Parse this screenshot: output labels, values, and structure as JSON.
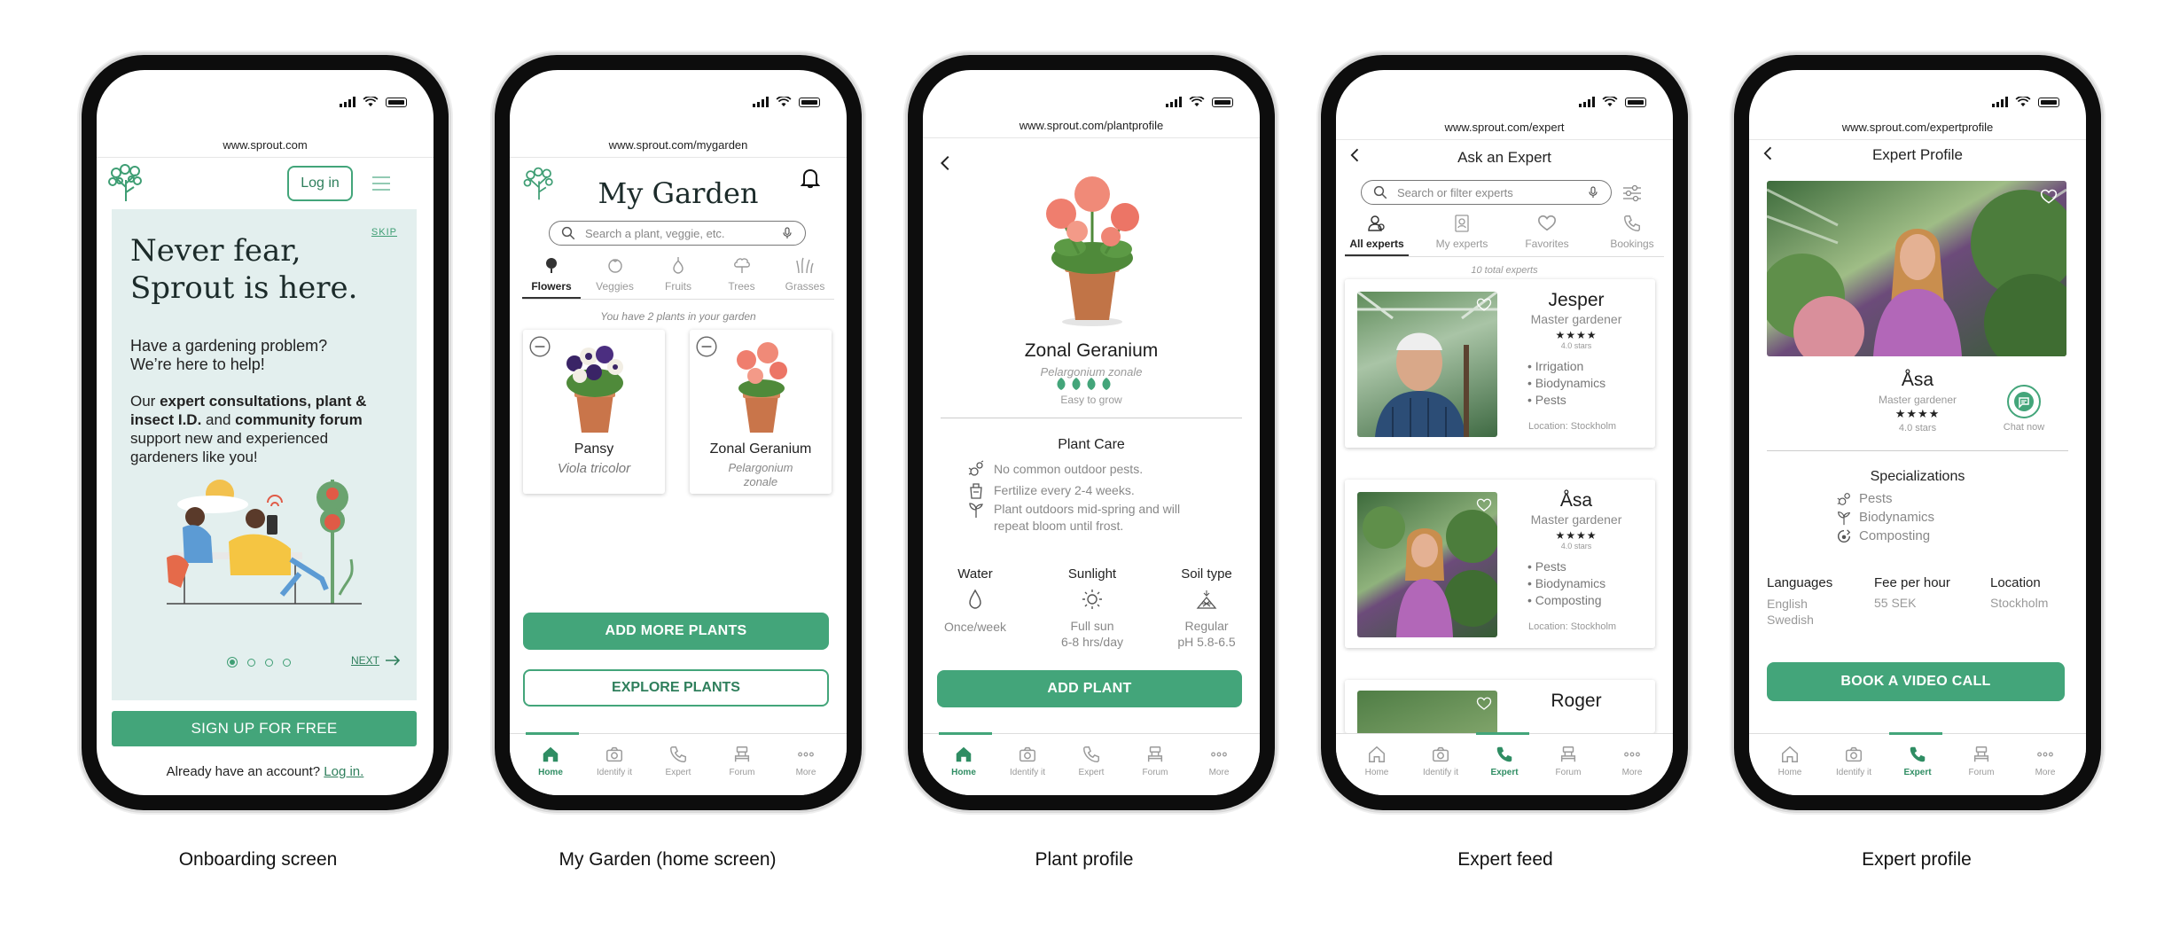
{
  "colors": {
    "accent": "#43a57a",
    "onboarding_bg": "#e3efee"
  },
  "captions": [
    "Onboarding screen",
    "My Garden (home screen)",
    "Plant profile",
    "Expert feed",
    "Expert profile"
  ],
  "nav": {
    "home": "Home",
    "identify": "Identify it",
    "expert": "Expert",
    "forum": "Forum",
    "more": "More"
  },
  "onboarding": {
    "url": "www.sprout.com",
    "login_button": "Log in",
    "skip": "SKIP",
    "headline_1": "Never fear,",
    "headline_2": "Sprout is here.",
    "problem_1": "Have a gardening problem?",
    "problem_2": "We’re here to help!",
    "body_1": "Our ",
    "body_bold_1": "expert consultations, plant &",
    "body_bold_2": "insect I.D.",
    "body_2": " and ",
    "body_bold_3": "community forum",
    "body_3": "support new and experienced",
    "body_4": "gardeners like you!",
    "next": "NEXT",
    "signup": "SIGN UP FOR FREE",
    "have_account": "Already have an account? ",
    "login_link": "Log in."
  },
  "garden": {
    "url": "www.sprout.com/mygarden",
    "title": "My Garden",
    "search_placeholder": "Search a plant, veggie, etc.",
    "categories": [
      "Flowers",
      "Veggies",
      "Fruits",
      "Trees",
      "Grasses"
    ],
    "count_note": "You have 2 plants in your garden",
    "plants": [
      {
        "name": "Pansy",
        "latin": "Viola tricolor"
      },
      {
        "name": "Zonal Geranium",
        "latin_1": "Pelargonium",
        "latin_2": "zonale"
      }
    ],
    "add_more": "ADD MORE PLANTS",
    "explore": "EXPLORE PLANTS"
  },
  "plant": {
    "url": "www.sprout.com/plantprofile",
    "name": "Zonal Geranium",
    "latin": "Pelargonium zonale",
    "difficulty": "Easy to grow",
    "care_title": "Plant Care",
    "care": [
      "No common outdoor pests.",
      "Fertilize every 2-4 weeks.",
      "Plant outdoors mid-spring and will",
      "repeat bloom until frost."
    ],
    "water_label": "Water",
    "water_value": "Once/week",
    "sun_label": "Sunlight",
    "sun_value_1": "Full sun",
    "sun_value_2": "6-8 hrs/day",
    "soil_label": "Soil type",
    "soil_value_1": "Regular",
    "soil_value_2": "pH 5.8-6.5",
    "add_plant": "ADD PLANT"
  },
  "expert_feed": {
    "url": "www.sprout.com/expert",
    "title": "Ask an Expert",
    "search_placeholder": "Search or filter experts",
    "tabs": [
      "All experts",
      "My experts",
      "Favorites",
      "Bookings"
    ],
    "total": "10 total experts",
    "experts": [
      {
        "name": "Jesper",
        "role": "Master gardener",
        "stars": "★★★★",
        "rating": "4.0 stars",
        "specialties": [
          "Irrigation",
          "Biodynamics",
          "Pests"
        ],
        "location": "Location: Stockholm"
      },
      {
        "name": "Åsa",
        "role": "Master gardener",
        "stars": "★★★★",
        "rating": "4.0 stars",
        "specialties": [
          "Pests",
          "Biodynamics",
          "Composting"
        ],
        "location": "Location: Stockholm"
      },
      {
        "name": "Roger"
      }
    ]
  },
  "expert_profile": {
    "url": "www.sprout.com/expertprofile",
    "title": "Expert Profile",
    "name": "Åsa",
    "role": "Master gardener",
    "stars": "★★★★",
    "rating": "4.0 stars",
    "chat": "Chat now",
    "spec_title": "Specializations",
    "specs": [
      "Pests",
      "Biodynamics",
      "Composting"
    ],
    "languages_label": "Languages",
    "languages_1": "English",
    "languages_2": "Swedish",
    "fee_label": "Fee per hour",
    "fee_value": "55 SEK",
    "location_label": "Location",
    "location_value": "Stockholm",
    "book": "BOOK A VIDEO CALL"
  }
}
